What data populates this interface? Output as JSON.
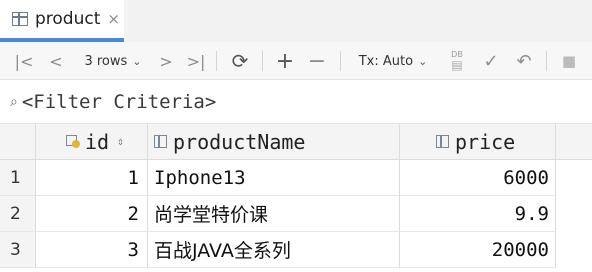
{
  "tab": {
    "label": "product",
    "close": "×"
  },
  "toolbar": {
    "first": "|<",
    "prev": "<",
    "rows_label": "3 rows",
    "next": ">",
    "last": ">|",
    "refresh": "⟳",
    "add": "+",
    "remove": "−",
    "tx_label": "Tx: Auto",
    "db_label": "DB",
    "commit": "✓",
    "rollback": "↶",
    "stop": "■"
  },
  "filter": {
    "placeholder": "<Filter Criteria>"
  },
  "table": {
    "columns": [
      "id",
      "productName",
      "price"
    ],
    "rows": [
      {
        "num": "1",
        "id": "1",
        "productName": "Iphone13",
        "price": "6000"
      },
      {
        "num": "2",
        "id": "2",
        "productName": "尚学堂特价课",
        "price": "9.9"
      },
      {
        "num": "3",
        "id": "3",
        "productName": "百战JAVA全系列",
        "price": "20000"
      }
    ]
  }
}
